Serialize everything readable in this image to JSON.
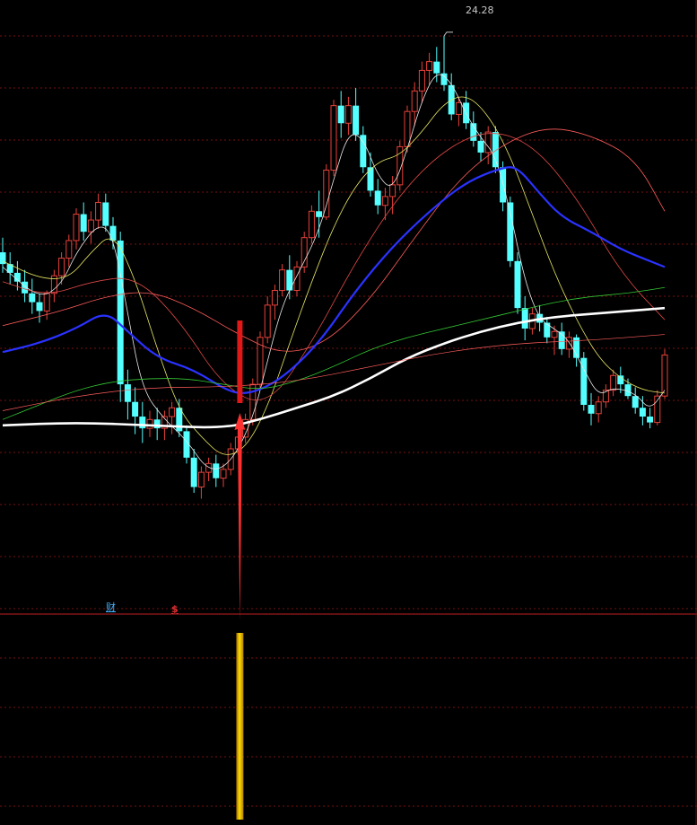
{
  "chart_data": {
    "type": "candlestick",
    "ylim": [
      4.6,
      25.5
    ],
    "grid": true,
    "peak_label": "24.28",
    "peak_price": 24.28,
    "markers": [
      "财",
      "$"
    ],
    "colors": {
      "up": "#e8413a",
      "down": "#54ffff",
      "ma5": "#e8e8e8",
      "ma10": "#e8e864",
      "ma20": "#e04848",
      "ma30": "#2a32ff",
      "ma60": "#34c834",
      "ma120": "#ff5c5c",
      "ma250": "#ffffff",
      "signal_arrow": "#ff3030",
      "signal_bar": "#ffc000",
      "grid": "#7a1010"
    },
    "candles": [
      [
        16.9,
        17.4,
        16.2,
        16.5
      ],
      [
        16.5,
        16.9,
        15.8,
        16.2
      ],
      [
        16.2,
        16.6,
        15.6,
        15.9
      ],
      [
        15.9,
        16.3,
        15.2,
        15.5
      ],
      [
        15.5,
        16.0,
        14.8,
        15.2
      ],
      [
        15.2,
        15.5,
        14.5,
        14.9
      ],
      [
        14.9,
        15.6,
        14.6,
        15.5
      ],
      [
        15.5,
        16.3,
        15.2,
        16.1
      ],
      [
        16.1,
        16.9,
        15.8,
        16.7
      ],
      [
        16.7,
        17.5,
        16.4,
        17.3
      ],
      [
        17.3,
        18.4,
        17.0,
        18.2
      ],
      [
        18.2,
        18.6,
        17.3,
        17.6
      ],
      [
        17.6,
        18.3,
        17.2,
        18.0
      ],
      [
        18.0,
        18.9,
        17.7,
        18.6
      ],
      [
        18.6,
        18.9,
        17.6,
        17.8
      ],
      [
        17.8,
        18.1,
        17.0,
        17.3
      ],
      [
        17.3,
        17.6,
        11.8,
        12.4
      ],
      [
        12.4,
        12.9,
        11.2,
        11.8
      ],
      [
        11.8,
        12.3,
        10.7,
        11.3
      ],
      [
        11.3,
        11.8,
        10.4,
        10.9
      ],
      [
        10.9,
        11.5,
        10.6,
        11.2
      ],
      [
        11.2,
        11.6,
        10.5,
        10.9
      ],
      [
        10.9,
        11.5,
        10.5,
        11.3
      ],
      [
        11.3,
        11.8,
        10.7,
        11.6
      ],
      [
        11.6,
        11.9,
        10.6,
        10.8
      ],
      [
        10.8,
        11.0,
        9.7,
        9.9
      ],
      [
        9.9,
        10.2,
        8.7,
        8.9
      ],
      [
        8.9,
        9.6,
        8.5,
        9.4
      ],
      [
        9.4,
        9.9,
        9.1,
        9.7
      ],
      [
        9.7,
        10.0,
        8.9,
        9.2
      ],
      [
        9.2,
        9.7,
        8.9,
        9.5
      ],
      [
        9.5,
        10.4,
        9.3,
        10.2
      ],
      [
        10.2,
        10.8,
        10.0,
        10.6
      ],
      [
        10.6,
        11.4,
        10.4,
        11.2
      ],
      [
        11.2,
        12.6,
        11.0,
        12.4
      ],
      [
        12.4,
        14.2,
        12.2,
        14.0
      ],
      [
        14.0,
        15.4,
        13.8,
        15.1
      ],
      [
        15.1,
        15.8,
        14.6,
        15.6
      ],
      [
        15.6,
        16.5,
        15.4,
        16.3
      ],
      [
        16.3,
        16.8,
        15.3,
        15.6
      ],
      [
        15.6,
        16.6,
        15.4,
        16.4
      ],
      [
        16.4,
        17.6,
        16.2,
        17.4
      ],
      [
        17.4,
        18.5,
        17.2,
        18.3
      ],
      [
        18.3,
        19.0,
        17.4,
        18.1
      ],
      [
        18.1,
        19.9,
        18.0,
        19.7
      ],
      [
        19.7,
        22.1,
        19.5,
        21.9
      ],
      [
        21.9,
        22.4,
        20.8,
        21.3
      ],
      [
        21.3,
        22.2,
        20.9,
        21.9
      ],
      [
        21.9,
        22.5,
        20.7,
        20.9
      ],
      [
        20.9,
        21.2,
        19.6,
        19.8
      ],
      [
        19.8,
        20.3,
        18.8,
        19.0
      ],
      [
        19.0,
        19.4,
        18.2,
        18.5
      ],
      [
        18.5,
        19.1,
        18.0,
        18.8
      ],
      [
        18.8,
        19.5,
        18.2,
        19.2
      ],
      [
        19.2,
        20.7,
        19.0,
        20.5
      ],
      [
        20.5,
        21.9,
        20.3,
        21.7
      ],
      [
        21.7,
        22.7,
        21.2,
        22.4
      ],
      [
        22.4,
        23.4,
        22.0,
        23.1
      ],
      [
        23.1,
        23.7,
        22.6,
        23.4
      ],
      [
        23.4,
        23.9,
        22.7,
        23.0
      ],
      [
        23.0,
        24.28,
        22.4,
        22.6
      ],
      [
        22.6,
        23.0,
        21.4,
        21.6
      ],
      [
        21.6,
        22.2,
        21.2,
        22.0
      ],
      [
        22.0,
        22.4,
        21.1,
        21.3
      ],
      [
        21.3,
        21.7,
        20.5,
        20.7
      ],
      [
        20.7,
        21.0,
        20.0,
        20.3
      ],
      [
        20.3,
        21.2,
        19.9,
        21.0
      ],
      [
        21.0,
        21.2,
        19.6,
        19.8
      ],
      [
        19.8,
        20.0,
        18.3,
        18.6
      ],
      [
        18.6,
        18.8,
        16.4,
        16.6
      ],
      [
        16.6,
        16.9,
        14.8,
        15.0
      ],
      [
        15.0,
        15.4,
        13.9,
        14.3
      ],
      [
        14.3,
        15.0,
        14.1,
        14.8
      ],
      [
        14.8,
        15.1,
        14.2,
        14.5
      ],
      [
        14.5,
        14.7,
        13.8,
        14.0
      ],
      [
        14.0,
        14.4,
        13.4,
        14.2
      ],
      [
        14.2,
        14.5,
        13.4,
        13.6
      ],
      [
        13.6,
        14.2,
        13.3,
        14.0
      ],
      [
        14.0,
        14.1,
        13.0,
        13.3
      ],
      [
        13.3,
        13.5,
        11.5,
        11.7
      ],
      [
        11.7,
        12.1,
        11.0,
        11.4
      ],
      [
        11.4,
        12.0,
        11.1,
        11.8
      ],
      [
        11.8,
        12.4,
        11.6,
        12.2
      ],
      [
        12.2,
        12.9,
        12.0,
        12.7
      ],
      [
        12.7,
        13.0,
        12.1,
        12.4
      ],
      [
        12.4,
        12.6,
        11.9,
        12.0
      ],
      [
        12.0,
        12.3,
        11.4,
        11.6
      ],
      [
        11.6,
        12.0,
        11.0,
        11.3
      ],
      [
        11.3,
        11.6,
        10.9,
        11.1
      ],
      [
        11.1,
        12.2,
        11.0,
        12.0
      ],
      [
        12.0,
        13.6,
        11.9,
        13.4
      ]
    ],
    "ma_lines": [
      {
        "key": "ma5",
        "width": 0.8,
        "points": [
          [
            0,
            16.4
          ],
          [
            5,
            15.3
          ],
          [
            8,
            15.8
          ],
          [
            10,
            16.9
          ],
          [
            13,
            17.9
          ],
          [
            15,
            17.5
          ],
          [
            17,
            14.8
          ],
          [
            19,
            12.2
          ],
          [
            22,
            11.2
          ],
          [
            25,
            10.5
          ],
          [
            28,
            9.4
          ],
          [
            31,
            9.7
          ],
          [
            34,
            11.2
          ],
          [
            36,
            13.2
          ],
          [
            38,
            15.1
          ],
          [
            40,
            16.1
          ],
          [
            43,
            17.6
          ],
          [
            45,
            19.4
          ],
          [
            47,
            21.0
          ],
          [
            49,
            20.8
          ],
          [
            51,
            19.5
          ],
          [
            53,
            19.0
          ],
          [
            55,
            20.4
          ],
          [
            57,
            22.1
          ],
          [
            59,
            23.1
          ],
          [
            61,
            22.7
          ],
          [
            63,
            21.6
          ],
          [
            65,
            20.8
          ],
          [
            67,
            20.2
          ],
          [
            69,
            18.3
          ],
          [
            71,
            15.9
          ],
          [
            73,
            14.6
          ],
          [
            75,
            14.3
          ],
          [
            77,
            13.9
          ],
          [
            79,
            12.9
          ],
          [
            81,
            12.0
          ],
          [
            83,
            12.3
          ],
          [
            86,
            12.1
          ],
          [
            88,
            11.5
          ],
          [
            90,
            12.2
          ]
        ]
      },
      {
        "key": "ma10",
        "width": 0.8,
        "points": [
          [
            0,
            16.6
          ],
          [
            5,
            16.0
          ],
          [
            9,
            16.0
          ],
          [
            12,
            16.9
          ],
          [
            15,
            17.6
          ],
          [
            18,
            16.0
          ],
          [
            21,
            13.6
          ],
          [
            24,
            11.5
          ],
          [
            27,
            10.6
          ],
          [
            30,
            9.9
          ],
          [
            33,
            10.2
          ],
          [
            36,
            11.6
          ],
          [
            39,
            13.8
          ],
          [
            42,
            15.9
          ],
          [
            45,
            17.8
          ],
          [
            48,
            19.2
          ],
          [
            51,
            20.0
          ],
          [
            54,
            20.2
          ],
          [
            57,
            21.0
          ],
          [
            60,
            22.0
          ],
          [
            63,
            22.3
          ],
          [
            66,
            21.6
          ],
          [
            69,
            20.2
          ],
          [
            72,
            18.2
          ],
          [
            75,
            16.2
          ],
          [
            78,
            14.6
          ],
          [
            81,
            13.3
          ],
          [
            84,
            12.6
          ],
          [
            87,
            12.2
          ],
          [
            90,
            12.1
          ]
        ]
      },
      {
        "key": "ma20",
        "width": 0.8,
        "points": [
          [
            0,
            15.9
          ],
          [
            6,
            15.4
          ],
          [
            12,
            15.9
          ],
          [
            18,
            16.1
          ],
          [
            24,
            14.6
          ],
          [
            30,
            12.3
          ],
          [
            36,
            11.6
          ],
          [
            42,
            13.8
          ],
          [
            48,
            16.6
          ],
          [
            54,
            18.9
          ],
          [
            60,
            20.4
          ],
          [
            66,
            21.1
          ],
          [
            72,
            20.6
          ],
          [
            78,
            18.8
          ],
          [
            84,
            16.2
          ],
          [
            90,
            14.6
          ]
        ]
      },
      {
        "key": "ma120",
        "width": 0.8,
        "points": [
          [
            0,
            14.4
          ],
          [
            8,
            14.9
          ],
          [
            14,
            15.4
          ],
          [
            20,
            15.6
          ],
          [
            26,
            15.0
          ],
          [
            32,
            14.1
          ],
          [
            38,
            13.4
          ],
          [
            44,
            13.8
          ],
          [
            50,
            15.3
          ],
          [
            56,
            17.4
          ],
          [
            62,
            19.4
          ],
          [
            68,
            20.6
          ],
          [
            74,
            21.2
          ],
          [
            80,
            20.9
          ],
          [
            86,
            20.1
          ],
          [
            90,
            18.3
          ]
        ]
      },
      {
        "key": "ma30",
        "width": 2.2,
        "points": [
          [
            0,
            13.5
          ],
          [
            5,
            13.8
          ],
          [
            10,
            14.3
          ],
          [
            14,
            14.9
          ],
          [
            17,
            14.2
          ],
          [
            21,
            13.3
          ],
          [
            26,
            12.9
          ],
          [
            31,
            12.1
          ],
          [
            34,
            12.1
          ],
          [
            38,
            12.6
          ],
          [
            43,
            13.8
          ],
          [
            48,
            15.6
          ],
          [
            53,
            17.1
          ],
          [
            58,
            18.3
          ],
          [
            63,
            19.3
          ],
          [
            68,
            19.8
          ],
          [
            70,
            19.8
          ],
          [
            73,
            18.9
          ],
          [
            76,
            18.1
          ],
          [
            80,
            17.6
          ],
          [
            84,
            17.0
          ],
          [
            88,
            16.6
          ],
          [
            90,
            16.4
          ]
        ]
      },
      {
        "key": "ma60",
        "width": 0.8,
        "points": [
          [
            0,
            11.2
          ],
          [
            5,
            11.7
          ],
          [
            10,
            12.2
          ],
          [
            15,
            12.5
          ],
          [
            20,
            12.6
          ],
          [
            25,
            12.6
          ],
          [
            30,
            12.4
          ],
          [
            35,
            12.2
          ],
          [
            40,
            12.5
          ],
          [
            45,
            13.0
          ],
          [
            50,
            13.6
          ],
          [
            55,
            14.0
          ],
          [
            60,
            14.3
          ],
          [
            65,
            14.6
          ],
          [
            70,
            14.9
          ],
          [
            75,
            15.2
          ],
          [
            80,
            15.4
          ],
          [
            85,
            15.5
          ],
          [
            90,
            15.7
          ]
        ]
      },
      {
        "key": "ma250",
        "width": 2.6,
        "points": [
          [
            0,
            11.0
          ],
          [
            10,
            11.1
          ],
          [
            20,
            11.0
          ],
          [
            30,
            10.9
          ],
          [
            35,
            11.2
          ],
          [
            40,
            11.6
          ],
          [
            45,
            12.0
          ],
          [
            50,
            12.6
          ],
          [
            55,
            13.3
          ],
          [
            60,
            13.8
          ],
          [
            65,
            14.2
          ],
          [
            70,
            14.5
          ],
          [
            75,
            14.7
          ],
          [
            80,
            14.8
          ],
          [
            85,
            14.9
          ],
          [
            90,
            15.0
          ]
        ]
      },
      {
        "key": "ma120",
        "width": 0.7,
        "points": [
          [
            0,
            11.5
          ],
          [
            10,
            12.0
          ],
          [
            20,
            12.3
          ],
          [
            30,
            12.3
          ],
          [
            40,
            12.5
          ],
          [
            50,
            13.0
          ],
          [
            60,
            13.5
          ],
          [
            70,
            13.8
          ],
          [
            80,
            13.9
          ],
          [
            90,
            14.1
          ]
        ]
      }
    ],
    "signal_index": 32,
    "signal_bar_ratio": 1.0
  }
}
